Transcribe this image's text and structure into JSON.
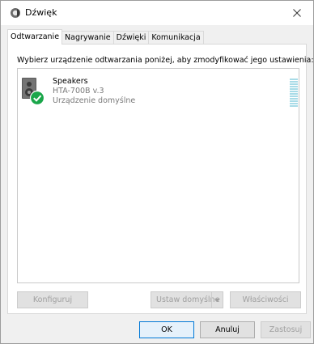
{
  "window": {
    "title": "Dźwięk"
  },
  "tabs": [
    {
      "label": "Odtwarzanie",
      "active": true
    },
    {
      "label": "Nagrywanie",
      "active": false
    },
    {
      "label": "Dźwięki",
      "active": false
    },
    {
      "label": "Komunikacja",
      "active": false
    }
  ],
  "playback": {
    "instruction": "Wybierz urządzenie odtwarzania poniżej, aby zmodyfikować jego ustawienia:",
    "devices": [
      {
        "name": "Speakers",
        "model": "HTA-700B v.3",
        "status": "Urządzenie domyślne",
        "level": 0
      }
    ],
    "buttons": {
      "configure": "Konfiguruj",
      "set_default": "Ustaw domyślne",
      "properties": "Właściwości"
    }
  },
  "dialog_buttons": {
    "ok": "OK",
    "cancel": "Anuluj",
    "apply": "Zastosuj"
  },
  "colors": {
    "accent": "#0078d7",
    "check_green": "#1aa64a",
    "meter": "#a8dbe7",
    "disabled_text": "#a0a0a0"
  },
  "icons": {
    "title": "speaker-icon",
    "device": "speaker-device-icon",
    "default_badge": "green-check-icon"
  }
}
